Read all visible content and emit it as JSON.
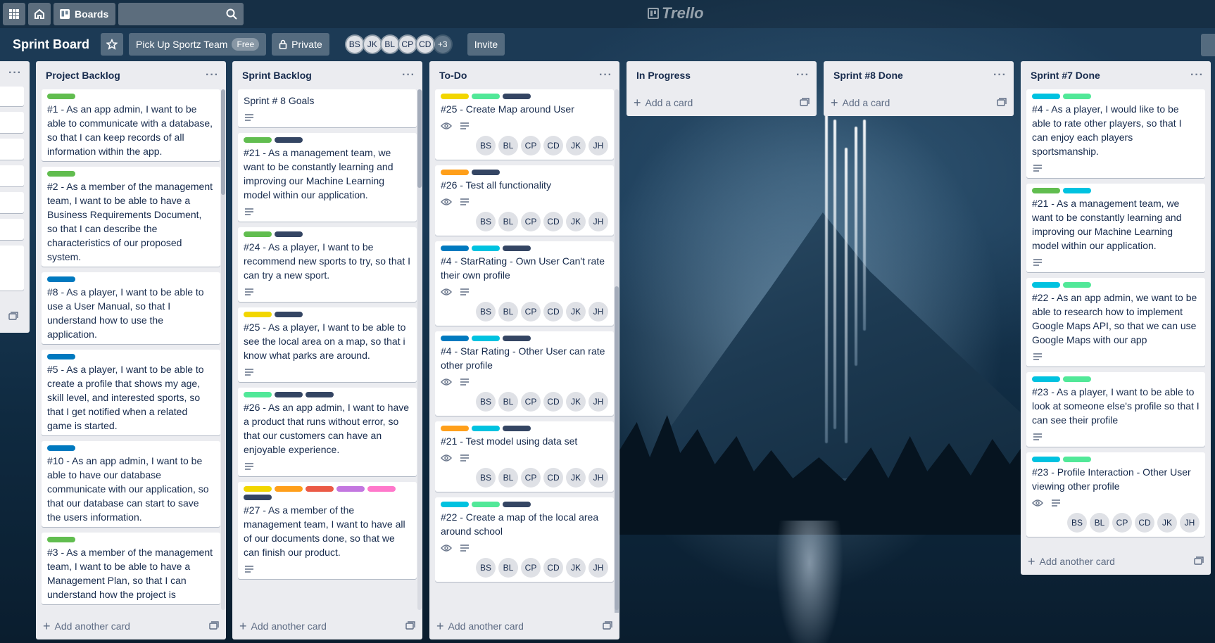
{
  "colors": {
    "green": "#61bd4f",
    "navy": "#344563",
    "blue": "#0079bf",
    "sky": "#00c2e0",
    "lime": "#51e898",
    "yellow": "#f2d600",
    "orange": "#ff9f1a",
    "red": "#eb5a46",
    "purple": "#c377e0",
    "pink": "#ff78cb"
  },
  "topbar": {
    "boards_label": "Boards",
    "logo_text": "Trello"
  },
  "board": {
    "title": "Sprint Board",
    "team_name": "Pick Up Sportz Team",
    "team_badge": "Free",
    "visibility": "Private",
    "members": [
      "BS",
      "JK",
      "BL",
      "CP",
      "CD"
    ],
    "members_more": "+3",
    "invite_label": "Invite"
  },
  "lists": [
    {
      "title": "Project Backlog",
      "footer": "Add another card",
      "cards": [
        {
          "labels": [
            "green"
          ],
          "text": "#1 - As an app admin, I want to be able to communicate with a database, so that I can keep records of all information within the app."
        },
        {
          "labels": [
            "green"
          ],
          "text": "#2 - As a member of the management team, I want to be able to have a Business Requirements Document, so that I can describe the characteristics of our proposed system."
        },
        {
          "labels": [
            "blue"
          ],
          "text": "#8 - As a player, I want to be able to use a User Manual, so that I understand how to use the application."
        },
        {
          "labels": [
            "blue"
          ],
          "text": "#5 - As a player, I want to be able to create a profile that shows my age, skill level, and interested sports, so that I get notified when a related game is started."
        },
        {
          "labels": [
            "blue"
          ],
          "text": "#10 - As an app admin, I want to be able to have our database communicate with our application, so that our database can start to save the users information."
        },
        {
          "labels": [
            "green"
          ],
          "text": "#3 - As a member of the management team, I want to be able to have a Management Plan, so that I can understand how the project is"
        }
      ]
    },
    {
      "title": "Sprint Backlog",
      "footer": "Add another card",
      "cards": [
        {
          "labels": [],
          "text": "Sprint # 8 Goals",
          "desc": true
        },
        {
          "labels": [
            "green",
            "navy"
          ],
          "text": "#21 - As a management team, we want to be constantly learning and improving our Machine Learning model within our application.",
          "desc": true
        },
        {
          "labels": [
            "green",
            "navy"
          ],
          "text": "#24 - As a player, I want to be recommend new sports to try, so that I can try a new sport.",
          "desc": true
        },
        {
          "labels": [
            "yellow",
            "navy"
          ],
          "text": "#25 - As a player, I want to be able to see the local area on a map, so that i know what parks are around.",
          "desc": true
        },
        {
          "labels": [
            "lime",
            "navy",
            "navy"
          ],
          "text": "#26 - As an app admin, I want to have a product that runs without error, so that our customers can have an enjoyable experience.",
          "desc": true
        },
        {
          "labels": [
            "yellow",
            "orange",
            "red",
            "purple",
            "pink",
            "navy"
          ],
          "text": "#27 - As a member of the management team, I want to have all of our documents done, so that we can finish our product.",
          "desc": true
        }
      ]
    },
    {
      "title": "To-Do",
      "footer": "Add another card",
      "members": [
        "BS",
        "BL",
        "CP",
        "CD",
        "JK",
        "JH"
      ],
      "cards": [
        {
          "labels": [
            "yellow",
            "lime",
            "navy"
          ],
          "text": "#25 - Create Map around User"
        },
        {
          "labels": [
            "orange",
            "navy"
          ],
          "text": "#26 - Test all functionality"
        },
        {
          "labels": [
            "blue",
            "sky",
            "navy"
          ],
          "text": "#4 - StarRating - Own User Can't rate their own profile"
        },
        {
          "labels": [
            "blue",
            "sky",
            "navy"
          ],
          "text": "#4 - Star Rating - Other User can rate other profile"
        },
        {
          "labels": [
            "orange",
            "sky",
            "navy"
          ],
          "text": "#21 - Test model using data set"
        },
        {
          "labels": [
            "sky",
            "lime",
            "navy"
          ],
          "text": "#22 - Create a map of the local area around school"
        }
      ]
    },
    {
      "title": "In Progress",
      "footer": "Add a card",
      "cards": []
    },
    {
      "title": "Sprint #8 Done",
      "footer": "Add a card",
      "cards": []
    },
    {
      "title": "Sprint #7 Done",
      "footer": "Add another card",
      "members": [
        "BS",
        "BL",
        "CP",
        "CD",
        "JK",
        "JH"
      ],
      "cards": [
        {
          "labels": [
            "sky",
            "lime"
          ],
          "text": "#4 - As a player, I would like to be able to rate other players, so that I can enjoy each players sportsmanship.",
          "desc": true
        },
        {
          "labels": [
            "green",
            "sky"
          ],
          "text": "#21 - As a management team, we want to be constantly learning and improving our Machine Learning model within our application.",
          "desc": true
        },
        {
          "labels": [
            "sky",
            "lime"
          ],
          "text": "#22 - As an app admin, we want to be able to research how to implement Google Maps API, so that we can use Google Maps with our app",
          "desc": true
        },
        {
          "labels": [
            "sky",
            "lime"
          ],
          "text": "#23 - As a player, I want to be able to look at someone else's profile so that I can see their profile",
          "desc": true
        },
        {
          "labels": [
            "sky",
            "lime"
          ],
          "text": "#23 - Profile Interaction - Other User viewing other profile",
          "watch": true,
          "desc": true,
          "avatars": true
        }
      ]
    }
  ]
}
